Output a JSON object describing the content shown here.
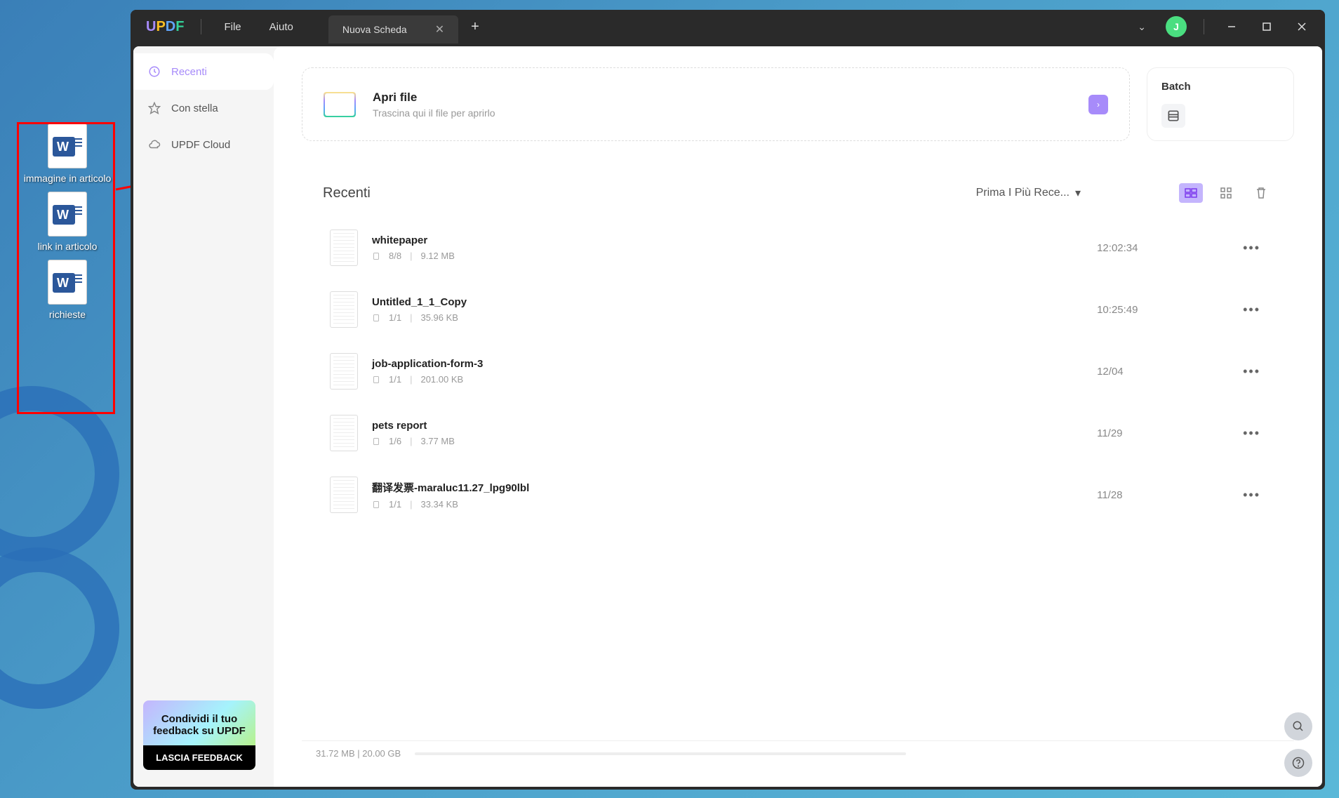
{
  "desktop": {
    "icons": [
      {
        "label": "immagine in articolo"
      },
      {
        "label": "link in articolo"
      },
      {
        "label": "richieste"
      }
    ]
  },
  "titlebar": {
    "menus": [
      "File",
      "Aiuto"
    ],
    "tab_label": "Nuova Scheda",
    "avatar_letter": "J"
  },
  "sidebar": {
    "items": [
      {
        "label": "Recenti",
        "active": true
      },
      {
        "label": "Con stella",
        "active": false
      },
      {
        "label": "UPDF Cloud",
        "active": false
      }
    ]
  },
  "feedback": {
    "text": "Condividi il tuo feedback su UPDF",
    "button": "LASCIA FEEDBACK"
  },
  "open_file": {
    "title": "Apri file",
    "subtitle": "Trascina qui il file per aprirlo"
  },
  "batch": {
    "title": "Batch"
  },
  "recent": {
    "title": "Recenti",
    "sort_label": "Prima I Più Rece...",
    "files": [
      {
        "name": "whitepaper",
        "pages": "8/8",
        "size": "9.12 MB",
        "date": "12:02:34"
      },
      {
        "name": "Untitled_1_1_Copy",
        "pages": "1/1",
        "size": "35.96 KB",
        "date": "10:25:49"
      },
      {
        "name": "job-application-form-3",
        "pages": "1/1",
        "size": "201.00 KB",
        "date": "12/04"
      },
      {
        "name": "pets report",
        "pages": "1/6",
        "size": "3.77 MB",
        "date": "11/29"
      },
      {
        "name": "翻译发票-maraluc11.27_lpg90lbl",
        "pages": "1/1",
        "size": "33.34 KB",
        "date": "11/28"
      }
    ]
  },
  "status": {
    "storage": "31.72 MB | 20.00 GB"
  }
}
